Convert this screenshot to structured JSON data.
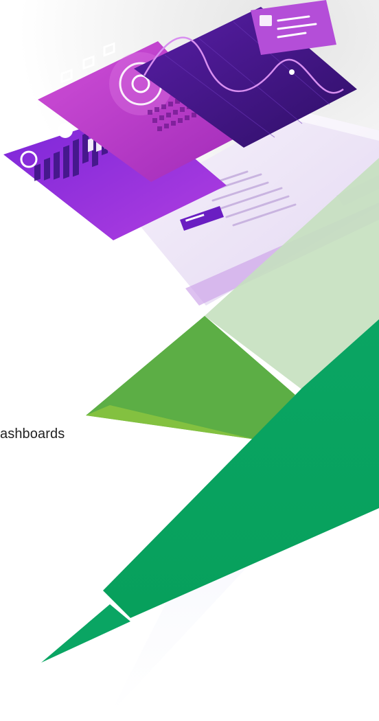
{
  "caption": {
    "text": "ashboards"
  },
  "colors": {
    "green_dark": "#0aa563",
    "green_mid": "#5cae45",
    "green_light": "#c5e0bf",
    "purple_dark": "#4a1a8a",
    "purple": "#8a2be2",
    "magenta": "#c23ec9"
  },
  "illustration": {
    "icon": "dashboard-illustration"
  }
}
